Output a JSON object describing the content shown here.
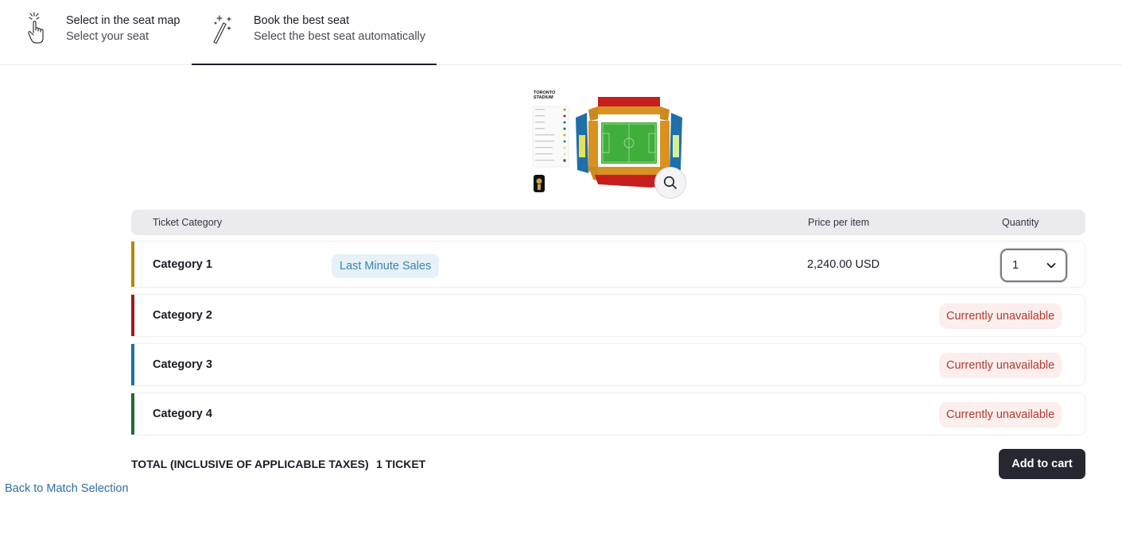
{
  "tabs": [
    {
      "title": "Select in the seat map",
      "subtitle": "Select your seat",
      "icon": "pointer-hand-icon",
      "active": false
    },
    {
      "title": "Book the best seat",
      "subtitle": "Select the best seat automatically",
      "icon": "magic-wand-icon",
      "active": true
    }
  ],
  "stadium": {
    "name_line1": "TORONTO",
    "name_line2": "STADIUM",
    "zoom_icon": "search-icon"
  },
  "table": {
    "headers": {
      "category": "Ticket Category",
      "price": "Price per item",
      "quantity": "Quantity"
    },
    "rows": [
      {
        "name": "Category 1",
        "color": "#b8860b",
        "badge": "Last Minute Sales",
        "price": "2,240.00 USD",
        "quantity": "1",
        "available": true
      },
      {
        "name": "Category 2",
        "color": "#9c1c1c",
        "status": "Currently unavailable",
        "available": false
      },
      {
        "name": "Category 3",
        "color": "#1f6fa8",
        "status": "Currently unavailable",
        "available": false
      },
      {
        "name": "Category 4",
        "color": "#1d6b3a",
        "status": "Currently unavailable",
        "available": false
      }
    ]
  },
  "footer": {
    "total_label": "TOTAL (INCLUSIVE OF APPLICABLE TAXES)",
    "total_tickets": "1 TICKET",
    "add_to_cart": "Add to cart",
    "back_link": "Back to Match Selection"
  },
  "colors": {
    "primary_button": "#272732",
    "unavailable_text": "#b33a2e",
    "unavailable_bg": "#fbeeed",
    "badge_text": "#3b84b0",
    "badge_bg": "#e6f1f8",
    "link": "#2f6ea3"
  }
}
